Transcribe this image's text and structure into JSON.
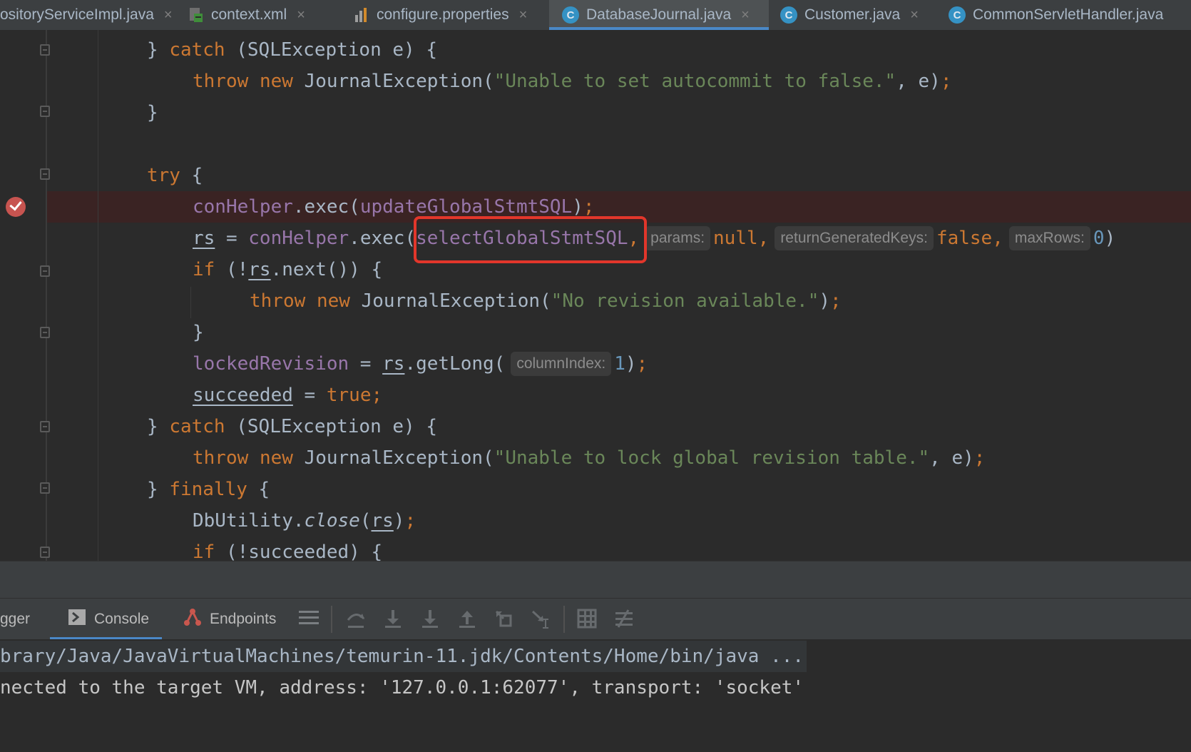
{
  "tabs": [
    {
      "label": "ositoryServiceImpl.java",
      "icon": "none",
      "active": false
    },
    {
      "label": "context.xml",
      "icon": "xml-file-icon",
      "active": false
    },
    {
      "label": "configure.properties",
      "icon": "properties-file-icon",
      "active": false
    },
    {
      "label": "DatabaseJournal.java",
      "icon": "java-class-icon",
      "active": true
    },
    {
      "label": "Customer.java",
      "icon": "java-class-icon",
      "active": false
    },
    {
      "label": "CommonServletHandler.java",
      "icon": "java-class-icon",
      "active": false
    }
  ],
  "tab_close_glyph": "×",
  "class_icon_letter": "C",
  "code": {
    "l1": {
      "a": "} ",
      "b": "catch",
      "c": " (SQLException e) {"
    },
    "l2": {
      "a": "throw",
      "b": " ",
      "c": "new",
      "d": " JournalException(",
      "e": "\"Unable to set autocommit to false.\"",
      "f": ", e)",
      "g": ";"
    },
    "l3": {
      "a": "}"
    },
    "l5": {
      "a": "try",
      "b": " {"
    },
    "l6": {
      "a": "conHelper",
      "b": ".exec(",
      "c": "updateGlobalStmtSQL",
      "d": ")",
      "e": ";"
    },
    "l7": {
      "a": "rs",
      "b": " = ",
      "c": "conHelper",
      "d": ".exec(",
      "e": "selectGlobalStmtSQL",
      "f": ",",
      "hint1": "params:",
      "g": "null",
      "h": ",",
      "hint2": "returnGeneratedKeys:",
      "i": "false",
      "j": ",",
      "hint3": "maxRows:",
      "k": "0",
      "l": ")"
    },
    "l8": {
      "a": "if",
      "b": " (!",
      "c": "rs",
      "d": ".next()) {"
    },
    "l9": {
      "a": "throw",
      "b": " ",
      "c": "new",
      "d": " JournalException(",
      "e": "\"No revision available.\"",
      "f": ")",
      "g": ";"
    },
    "l10": {
      "a": "}"
    },
    "l11": {
      "a": "lockedRevision",
      "b": " = ",
      "c": "rs",
      "d": ".getLong(",
      "hint": "columnIndex:",
      "e": "1",
      "f": ")",
      "g": ";"
    },
    "l12": {
      "a": "succeeded",
      "b": " = ",
      "c": "true",
      "d": ";"
    },
    "l13": {
      "a": "} ",
      "b": "catch",
      "c": " (SQLException e) {"
    },
    "l14": {
      "a": "throw",
      "b": " ",
      "c": "new",
      "d": " JournalException(",
      "e": "\"Unable to lock global revision table.\"",
      "f": ", e)",
      "g": ";"
    },
    "l15": {
      "a": "} ",
      "b": "finally",
      "c": " {"
    },
    "l16": {
      "a": "DbUtility.",
      "b": "close",
      "c": "(",
      "d": "rs",
      "e": ")",
      "f": ";"
    },
    "l17": {
      "a": "if",
      "b": " (!succeeded) {"
    }
  },
  "debug_tabs": [
    {
      "label": "gger",
      "icon": "none"
    },
    {
      "label": "Console",
      "icon": "console-icon",
      "active": true
    },
    {
      "label": "Endpoints",
      "icon": "endpoints-icon"
    }
  ],
  "toolbar_icons": [
    "menu-icon",
    "step-over-icon",
    "step-into-icon",
    "force-step-into-icon",
    "step-out-icon",
    "drop-frame-icon",
    "run-to-cursor-icon",
    "evaluate-icon",
    "trace-icon"
  ],
  "console": [
    "brary/Java/JavaVirtualMachines/temurin-11.jdk/Contents/Home/bin/java ...",
    "nected to the target VM, address: '127.0.0.1:62077', transport: 'socket'"
  ],
  "colors": {
    "keyword": "#cc7832",
    "string": "#6a8759",
    "field": "#9876aa",
    "number": "#6897bb",
    "highlight_box": "#e2362b",
    "breakpoint": "#c75450"
  }
}
